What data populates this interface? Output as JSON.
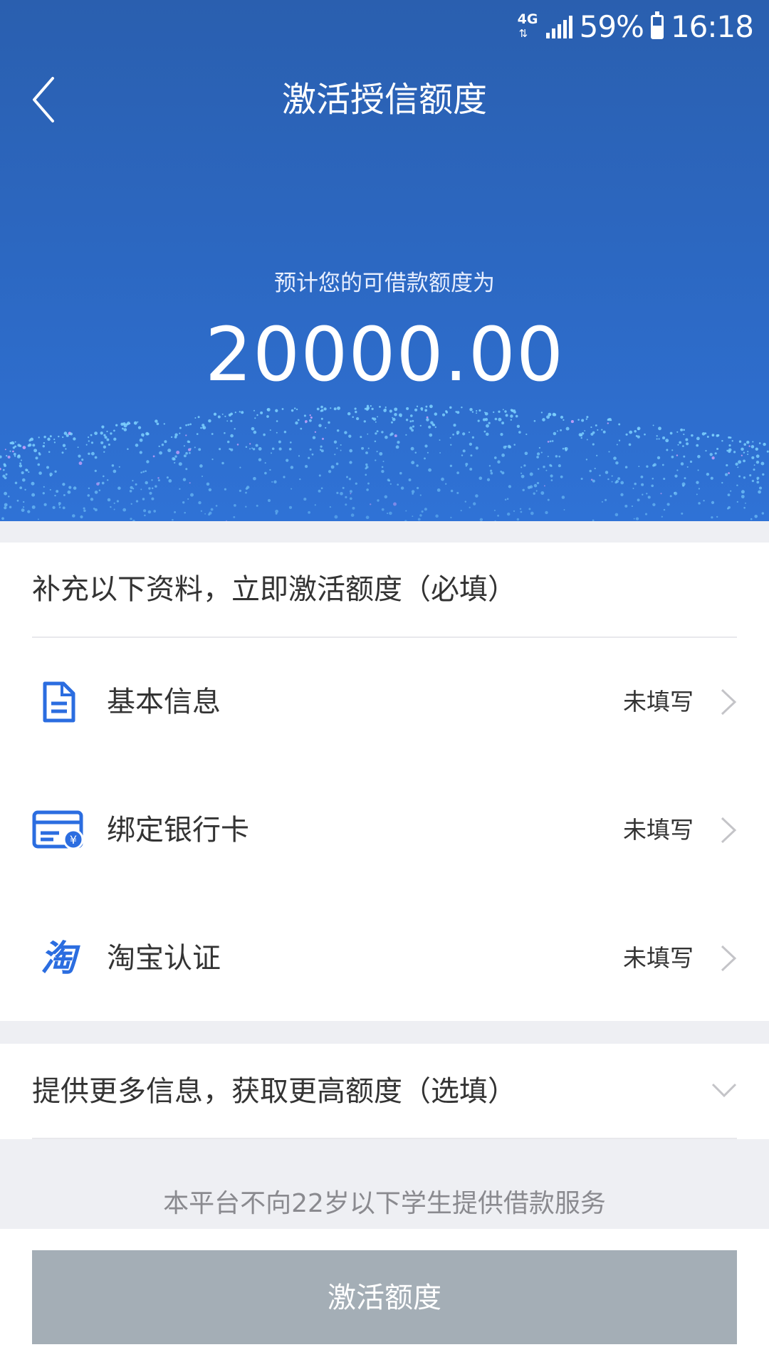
{
  "status_bar": {
    "network": "4G",
    "battery": "59%",
    "time": "16:18"
  },
  "header": {
    "title": "激活授信额度",
    "back_icon": "chevron-left-icon"
  },
  "hero": {
    "subtitle": "预计您的可借款额度为",
    "amount": "20000.00"
  },
  "required_section": {
    "title": "补充以下资料，立即激活额度（必填）",
    "items": [
      {
        "icon": "document-icon",
        "label": "基本信息",
        "status": "未填写"
      },
      {
        "icon": "bank-card-icon",
        "label": "绑定银行卡",
        "status": "未填写"
      },
      {
        "icon": "taobao-icon",
        "icon_glyph": "淘",
        "label": "淘宝认证",
        "status": "未填写"
      }
    ]
  },
  "optional_section": {
    "title": "提供更多信息，获取更高额度（选填）",
    "expand_icon": "chevron-down-icon"
  },
  "notice": "本平台不向22岁以下学生提供借款服务",
  "footer": {
    "button_label": "激活额度"
  },
  "colors": {
    "hero_top": "#2a5faf",
    "hero_bottom": "#2f72d6",
    "icon_blue": "#2b6de0",
    "button_disabled": "#a4aeb6",
    "page_bg": "#eeeff3"
  }
}
